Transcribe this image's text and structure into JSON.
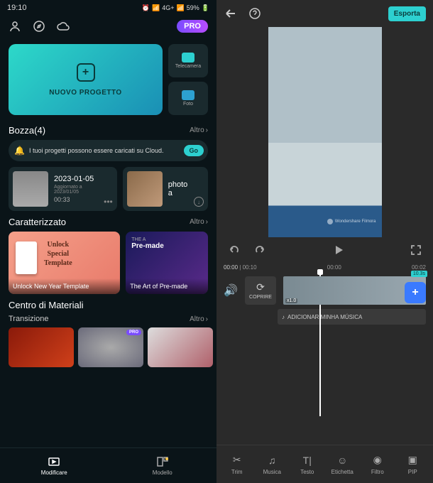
{
  "statusbar": {
    "time": "19:10",
    "battery": "59%",
    "network": "4G+"
  },
  "header": {
    "pro_label": "PRO"
  },
  "new_project": {
    "label": "NUOVO PROGETTO",
    "camera_label": "Telecamera",
    "photo_label": "Foto"
  },
  "drafts_section": {
    "title": "Bozza(4)",
    "more": "Altro",
    "banner_text": "I tuoi progetti possono essere caricati su Cloud.",
    "go_label": "Go",
    "items": [
      {
        "title": "2023-01-05",
        "subtitle": "Aggiornato a 2023/01/05",
        "duration": "00:33"
      },
      {
        "title": "photo a"
      }
    ]
  },
  "featured": {
    "title": "Caratterizzato",
    "more": "Altro",
    "items": [
      {
        "inner_lines": [
          "Unlock",
          "Special",
          "Template"
        ],
        "caption": "Unlock New Year Template"
      },
      {
        "top_prefix": "THE A",
        "top_main": "Pre-made",
        "caption": "The Art of Pre-made"
      }
    ]
  },
  "materials": {
    "title": "Centro di Materiali",
    "subtitle": "Transizione",
    "more": "Altro",
    "pro_badge": "PRO"
  },
  "left_nav": {
    "edit": "Modificare",
    "template": "Modello"
  },
  "editor": {
    "export_label": "Esporta",
    "watermark": "Wondershare Filmora",
    "time_current": "00:00",
    "time_total": "00:10",
    "ruler_mid": "00:00",
    "ruler_right": "00:02",
    "cover_label": "COPRIRE",
    "clip_speed": "x1.0",
    "clip_duration": "10.3s",
    "music_label": "ADICIONAR MINHA MÚSICA",
    "tools": {
      "trim": "Trim",
      "music": "Musica",
      "text": "Testo",
      "sticker": "Etichetta",
      "filter": "Filtro",
      "pip": "PIP"
    }
  }
}
